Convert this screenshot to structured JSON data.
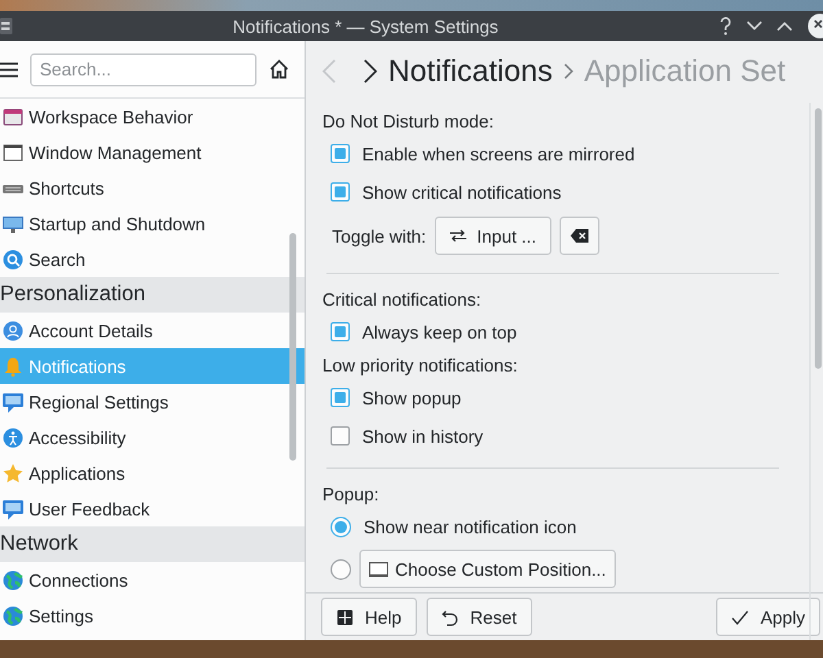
{
  "window": {
    "title": "Notifications * — System Settings"
  },
  "sidebar": {
    "search": {
      "placeholder": "Search..."
    },
    "items": [
      {
        "kind": "item",
        "label": "Workspace Behavior",
        "selected": false
      },
      {
        "kind": "item",
        "label": "Window Management",
        "selected": false
      },
      {
        "kind": "item",
        "label": "Shortcuts",
        "selected": false
      },
      {
        "kind": "item",
        "label": "Startup and Shutdown",
        "selected": false
      },
      {
        "kind": "item",
        "label": "Search",
        "selected": false
      },
      {
        "kind": "category",
        "label": "Personalization"
      },
      {
        "kind": "item",
        "label": "Account Details",
        "selected": false
      },
      {
        "kind": "item",
        "label": "Notifications",
        "selected": true
      },
      {
        "kind": "item",
        "label": "Regional Settings",
        "selected": false
      },
      {
        "kind": "item",
        "label": "Accessibility",
        "selected": false
      },
      {
        "kind": "item",
        "label": "Applications",
        "selected": false
      },
      {
        "kind": "item",
        "label": "User Feedback",
        "selected": false
      },
      {
        "kind": "category",
        "label": "Network"
      },
      {
        "kind": "item",
        "label": "Connections",
        "selected": false
      },
      {
        "kind": "item",
        "label": "Settings",
        "selected": false
      }
    ]
  },
  "header": {
    "back": {
      "disabled": true
    },
    "forward": {
      "disabled": false
    },
    "breadcrumb": [
      {
        "label": "Notifications",
        "current": true
      },
      {
        "label": "Application Set",
        "current": false
      }
    ]
  },
  "options": [
    {
      "kind": "heading",
      "text": "Do Not Disturb mode:"
    },
    {
      "kind": "checkbox",
      "label": "Enable when screens are mirrored",
      "checked": true
    },
    {
      "kind": "checkbox",
      "label": "Show critical notifications",
      "checked": true
    },
    {
      "kind": "shortcut",
      "label": "Toggle with:",
      "button": "Input ..."
    },
    {
      "kind": "divider"
    },
    {
      "kind": "heading",
      "text": "Critical notifications:"
    },
    {
      "kind": "checkbox",
      "label": "Always keep on top",
      "checked": true
    },
    {
      "kind": "heading",
      "text": "Low priority notifications:"
    },
    {
      "kind": "checkbox",
      "label": "Show popup",
      "checked": true
    },
    {
      "kind": "checkbox",
      "label": "Show in history",
      "checked": false
    },
    {
      "kind": "divider"
    },
    {
      "kind": "heading",
      "text": "Popup:"
    },
    {
      "kind": "radio",
      "label": "Show near notification icon",
      "selected": true
    },
    {
      "kind": "radio_button",
      "label": "Choose Custom Position...",
      "selected": false
    }
  ],
  "footer": {
    "buttons": [
      {
        "kind": "help",
        "label": "Help"
      },
      {
        "kind": "reset",
        "label": "Reset"
      },
      {
        "kind": "apply",
        "label": "Apply"
      }
    ]
  }
}
